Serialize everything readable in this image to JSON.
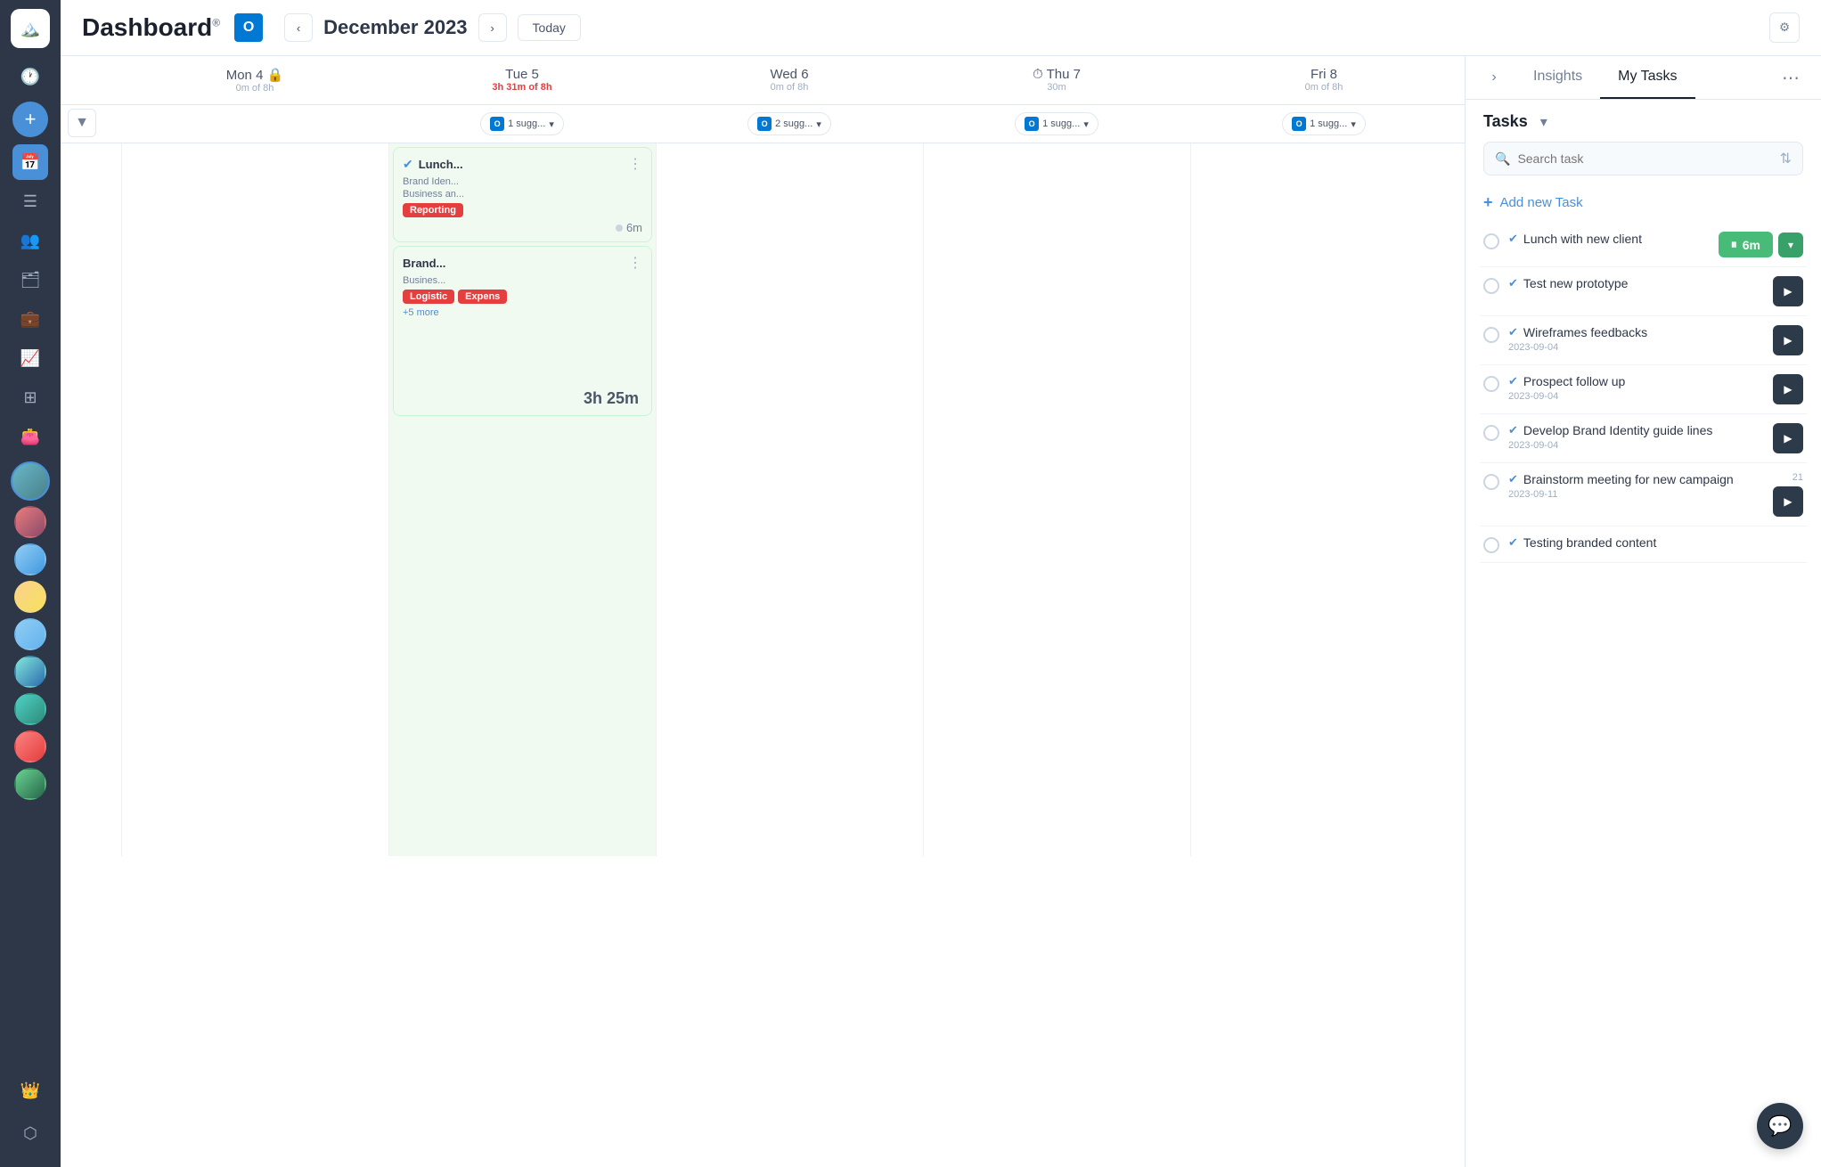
{
  "app": {
    "logo": "🏔️"
  },
  "header": {
    "title": "Dashboard",
    "title_sup": "®",
    "outlook_label": "O",
    "month": "December 2023",
    "today_label": "Today",
    "settings_icon": "⚙"
  },
  "sidebar": {
    "icons": [
      {
        "name": "clock-icon",
        "symbol": "🕐",
        "active": false
      },
      {
        "name": "add-icon",
        "symbol": "+",
        "special": true
      },
      {
        "name": "calendar-icon",
        "symbol": "📅",
        "active": true
      },
      {
        "name": "list-icon",
        "symbol": "☰",
        "active": false
      },
      {
        "name": "team-icon",
        "symbol": "👥",
        "active": false
      },
      {
        "name": "portfolio-icon",
        "symbol": "🗂",
        "active": false
      },
      {
        "name": "briefcase-icon",
        "symbol": "💼",
        "active": false
      },
      {
        "name": "chart-icon",
        "symbol": "📈",
        "active": false
      },
      {
        "name": "layers-icon",
        "symbol": "⊞",
        "active": false
      },
      {
        "name": "wallet-icon",
        "symbol": "👛",
        "active": false
      },
      {
        "name": "crown-icon",
        "symbol": "👑",
        "active": false
      },
      {
        "name": "cube-icon",
        "symbol": "⬡",
        "active": false
      }
    ],
    "avatars": [
      {
        "color": "#c53030",
        "bg": "#fed7d7"
      },
      {
        "color": "#3182ce",
        "bg": "#bee3f8"
      },
      {
        "color": "#d69e2e",
        "bg": "#fefcbf"
      },
      {
        "color": "#3182ce",
        "bg": "#bee3f8"
      },
      {
        "color": "#2b6cb0",
        "bg": "#ebf8ff"
      },
      {
        "color": "#276749",
        "bg": "#c6f6d5"
      },
      {
        "color": "#c53030",
        "bg": "#fed7d7"
      },
      {
        "color": "#276749",
        "bg": "#c6f6d5"
      }
    ]
  },
  "days": [
    {
      "name": "Mon 4",
      "time": "0m of 8h",
      "lock": true,
      "suggestions": null,
      "show_expand": true
    },
    {
      "name": "Tue 5",
      "time": "3h 31m of 8h",
      "lock": false,
      "suggestions": "1 sugg...",
      "show_expand": false
    },
    {
      "name": "Wed 6",
      "time": "0m of 8h",
      "lock": false,
      "suggestions": "2 sugg...",
      "show_expand": false
    },
    {
      "name": "Thu 7",
      "time": "30m",
      "lock": false,
      "suggestions": "1 sugg...",
      "show_expand": false,
      "clock": true
    },
    {
      "name": "Fri 8",
      "time": "0m of 8h",
      "lock": false,
      "suggestions": "1 sugg...",
      "show_expand": false
    }
  ],
  "tuesday_cards": [
    {
      "id": "lunch",
      "title": "Lunch...",
      "sub1": "Brand Iden...",
      "sub2": "Business an...",
      "tags": [
        "Reporting"
      ],
      "timer": "6m",
      "has_timer": true
    },
    {
      "id": "brand",
      "title": "Brand...",
      "sub1": "Busines...",
      "tags": [
        "Logistic",
        "Expens"
      ],
      "more": "+5 more",
      "duration": "3h 25m"
    }
  ],
  "right_panel": {
    "tabs": [
      "Insights",
      "My Tasks"
    ],
    "active_tab": "My Tasks",
    "tasks_label": "Tasks",
    "search_placeholder": "Search task",
    "add_task_label": "Add new Task",
    "tasks": [
      {
        "id": "t1",
        "title": "Lunch with new client",
        "date": null,
        "running": true,
        "timer_value": "6m"
      },
      {
        "id": "t2",
        "title": "Test new prototype",
        "date": null,
        "running": false
      },
      {
        "id": "t3",
        "title": "Wireframes feedbacks",
        "date": "2023-09-04",
        "running": false
      },
      {
        "id": "t4",
        "title": "Prospect follow up",
        "date": "2023-09-04",
        "running": false
      },
      {
        "id": "t5",
        "title": "Develop Brand Identity guide lines",
        "date": "2023-09-04",
        "running": false
      },
      {
        "id": "t6",
        "title": "Brainstorm meeting for new campaign",
        "date": "2023-09-11",
        "count": "21",
        "running": false
      },
      {
        "id": "t7",
        "title": "Testing branded content",
        "date": null,
        "running": false
      }
    ]
  }
}
